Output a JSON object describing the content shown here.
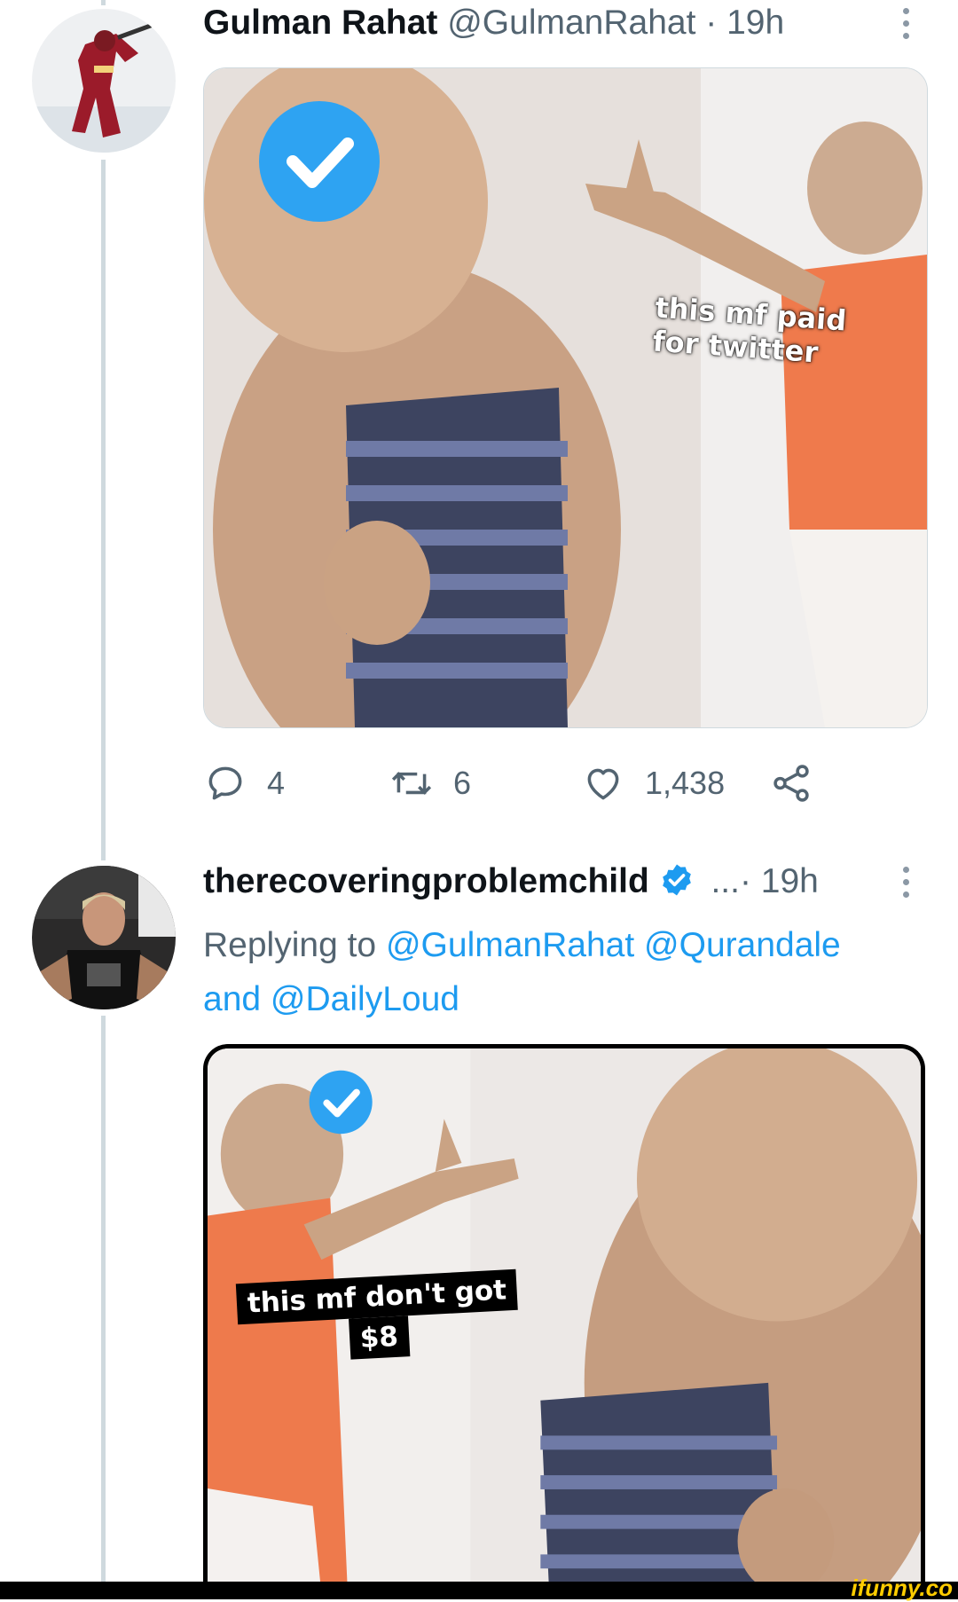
{
  "tweet1": {
    "display_name": "Gulman Rahat",
    "handle_time": "@GulmanRahat · 19h",
    "avatar_icon": "hockey-player-avatar",
    "media_caption_line1": "this mf paid",
    "media_caption_line2": "for twitter",
    "actions": {
      "reply_count": "4",
      "retweet_count": "6",
      "like_count": "1,438"
    }
  },
  "tweet2": {
    "display_name": "therecoveringproblemchild",
    "time": "...· 19h",
    "avatar_icon": "man-avatar",
    "replying_prefix": "Replying to",
    "mention1": "@GulmanRahat",
    "mention2": "@Qurandale",
    "and_word": "and",
    "mention3": "@DailyLoud",
    "media_caption_line1": "this mf don't got",
    "media_caption_line2": "$8"
  },
  "footer": {
    "brand": "ifunny.co"
  },
  "colors": {
    "accent": "#1d9bf0",
    "muted": "#536471",
    "thread_line": "#cfd9de"
  }
}
